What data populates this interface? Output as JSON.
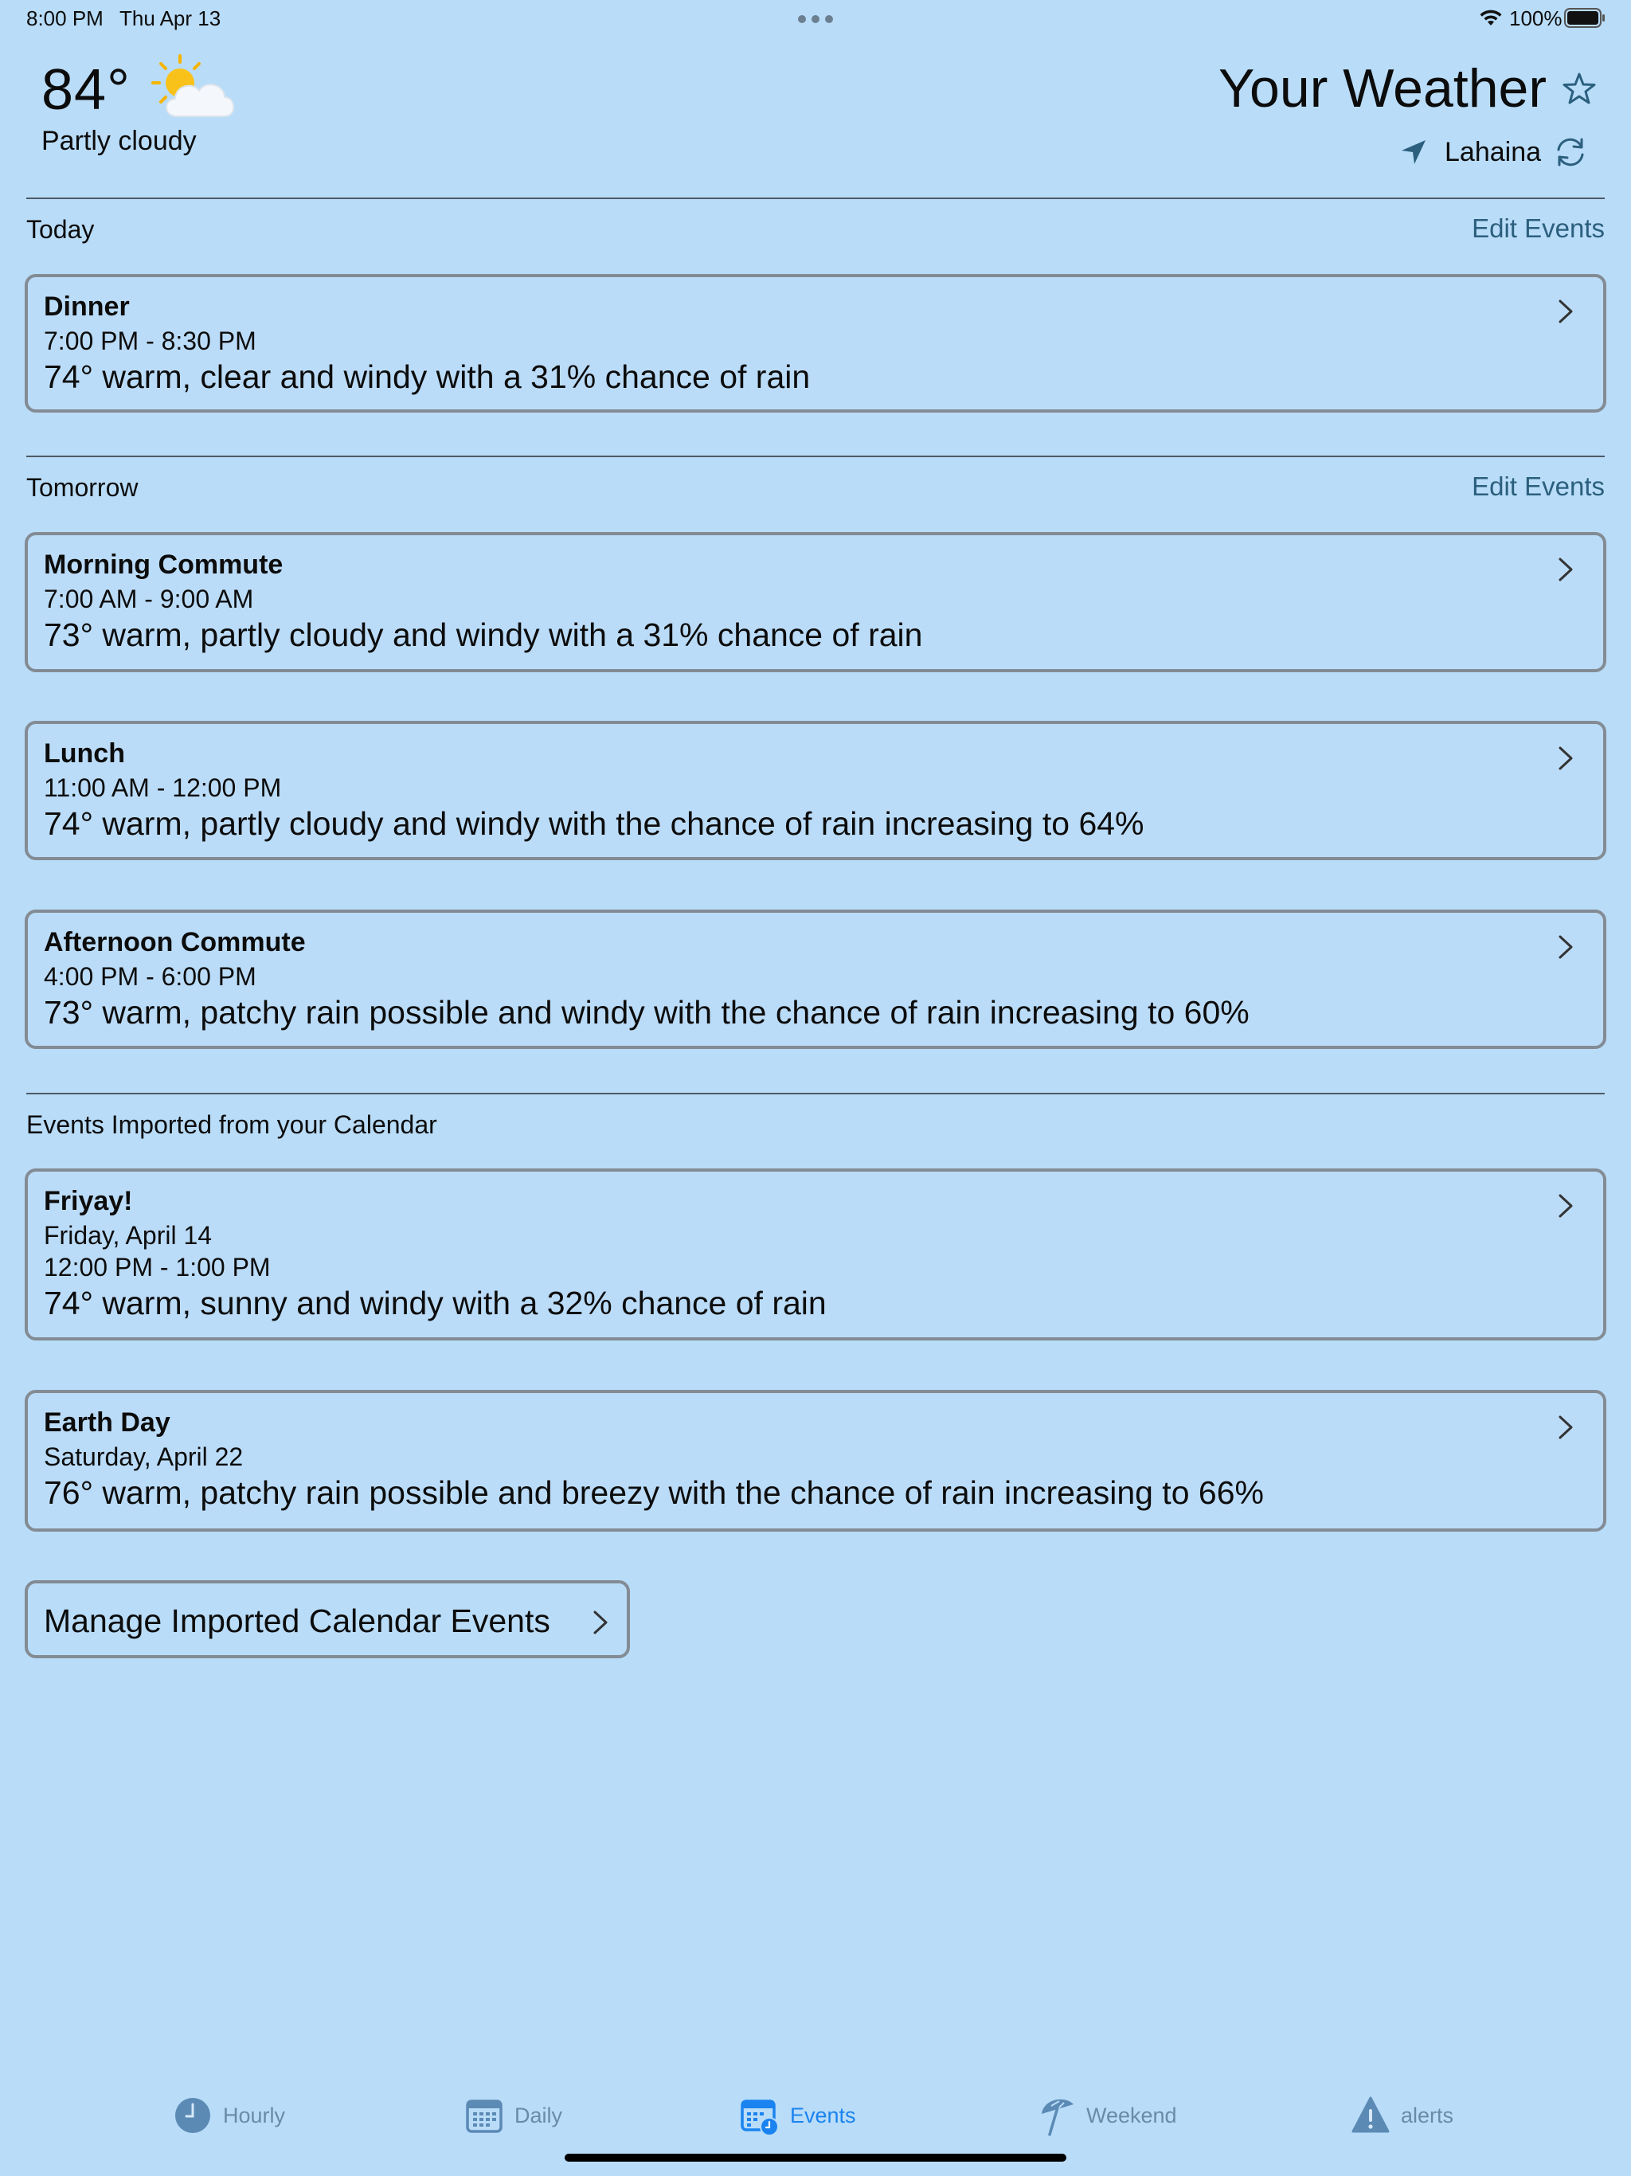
{
  "status_bar": {
    "time": "8:00 PM",
    "date": "Thu Apr 13",
    "battery": "100%"
  },
  "header": {
    "temperature": "84°",
    "condition": "Partly cloudy",
    "weather_icon": "partly-cloudy-icon",
    "title": "Your Weather",
    "location": "Lahaina"
  },
  "sections": {
    "today": {
      "label": "Today",
      "edit": "Edit Events"
    },
    "tomorrow": {
      "label": "Tomorrow",
      "edit": "Edit Events"
    },
    "imported": {
      "label": "Events Imported from your Calendar"
    }
  },
  "today_events": [
    {
      "name": "Dinner",
      "time": "7:00 PM  -  8:30 PM",
      "summary": "74° warm, clear and windy with a 31% chance of rain"
    }
  ],
  "tomorrow_events": [
    {
      "name": "Morning Commute",
      "time": "7:00 AM  -  9:00 AM",
      "summary": "73° warm, partly cloudy and windy with a 31% chance of rain"
    },
    {
      "name": "Lunch",
      "time": "11:00 AM  -  12:00 PM",
      "summary": "74° warm, partly cloudy and windy with the chance of rain increasing to 64%"
    },
    {
      "name": "Afternoon Commute",
      "time": "4:00 PM  -  6:00 PM",
      "summary": "73° warm, patchy rain possible and windy with the chance of rain increasing to 60%"
    }
  ],
  "imported_events": [
    {
      "name": "Friyay!",
      "date": "Friday, April 14",
      "time": "12:00 PM  -  1:00 PM",
      "summary": "74° warm, sunny and windy with a 32% chance of rain"
    },
    {
      "name": "Earth Day",
      "date": "Saturday, April 22",
      "summary": "76° warm, patchy rain possible and breezy with the chance of rain increasing to 66%"
    }
  ],
  "manage_button": "Manage Imported Calendar Events",
  "tabs": [
    {
      "label": "Hourly",
      "icon": "clock-icon"
    },
    {
      "label": "Daily",
      "icon": "calendar-grid-icon"
    },
    {
      "label": "Events",
      "icon": "calendar-clock-icon",
      "active": true
    },
    {
      "label": "Weekend",
      "icon": "beach-umbrella-icon"
    },
    {
      "label": "alerts",
      "icon": "warning-icon"
    }
  ],
  "colors": {
    "background": "#b9dcf8",
    "link": "#2b5f7e",
    "tab_active": "#1a83ef",
    "tab_inactive": "#6a8ba8"
  }
}
